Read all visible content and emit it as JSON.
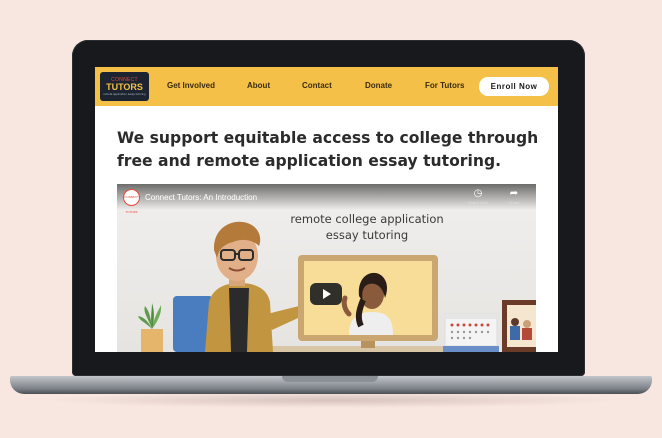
{
  "header": {
    "logo_line1": "CONNECT",
    "logo_line2": "TUTORS",
    "logo_tagline": "remote application essay tutoring",
    "nav": [
      "Get Involved",
      "About",
      "Contact",
      "Donate",
      "For Tutors"
    ],
    "enroll_label": "Enroll Now"
  },
  "hero": {
    "headline": "We support equitable access to college through free and remote application essay tutoring."
  },
  "video": {
    "title": "Connect Tutors: An Introduction",
    "caption_line1": "remote college application",
    "caption_line2": "essay tutoring",
    "watch_later_label": "Watch later",
    "share_label": "Share",
    "channel_thumb_text": "CONNECT TUTORS"
  },
  "colors": {
    "background": "#f8e6e1",
    "nav": "#f5c047",
    "logo_bg": "#1b2430",
    "laptop": "#17191c"
  }
}
